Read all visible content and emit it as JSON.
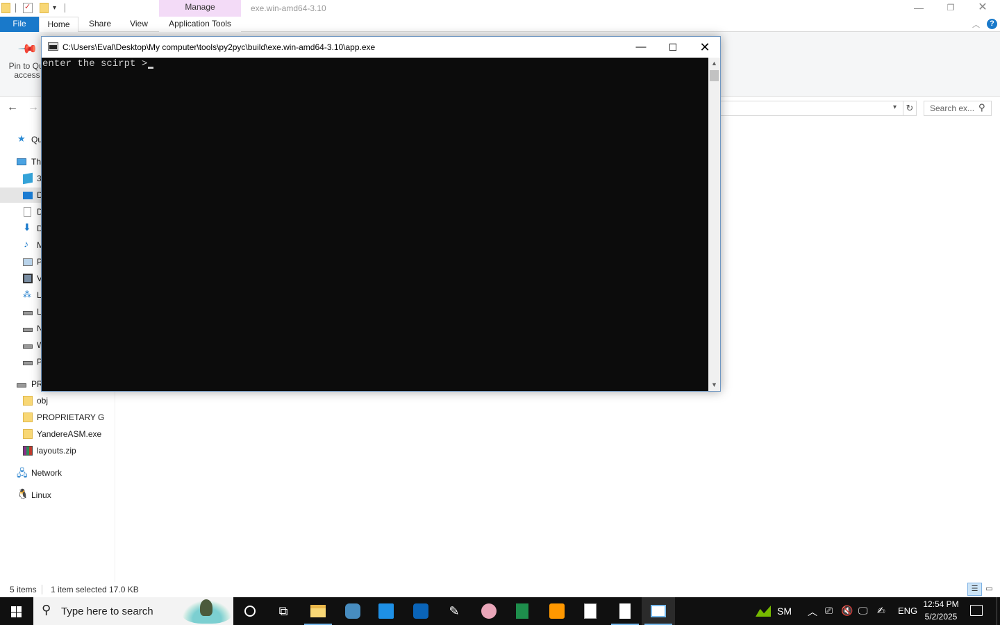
{
  "explorer": {
    "window_title": "exe.win-amd64-3.10",
    "manage_label": "Manage",
    "tabs": {
      "file": "File",
      "home": "Home",
      "share": "Share",
      "view": "View",
      "app_tools": "Application Tools"
    },
    "ribbon": {
      "pin_label_line1": "Pin to Qui",
      "pin_label_line2": "access"
    },
    "search_placeholder": "Search ex...",
    "nav": {
      "quick_access": "Qu",
      "this_pc": "Thi",
      "objects_3d": "3",
      "desktop": "D",
      "documents": "D",
      "downloads": "D",
      "music": "M",
      "pictures": "P",
      "videos": "V",
      "drive_l1": "L",
      "drive_l2": "L",
      "drive_n": "N",
      "drive_w": "W",
      "drive_p": "P",
      "proprietary_drive": "PR",
      "obj": "obj",
      "proprietary_g": "PROPRIETARY G",
      "yandere": "YandereASM.exe",
      "layouts": "layouts.zip",
      "network": "Network",
      "linux": "Linux"
    },
    "status": {
      "items": "5 items",
      "selected": "1 item selected  17.0 KB"
    }
  },
  "console": {
    "title": "C:\\Users\\Eval\\Desktop\\My computer\\tools\\py2pyc\\build\\exe.win-amd64-3.10\\app.exe",
    "prompt": "enter the scirpt > "
  },
  "taskbar": {
    "search_placeholder": "Type here to search",
    "tray": {
      "sm_label": "SM",
      "language": "ENG",
      "time": "12:54 PM",
      "date": "5/2/2025"
    }
  },
  "colors": {
    "file_tab": "#1979ca",
    "manage_band": "#f3dbf7",
    "console_bg": "#0c0c0c",
    "console_text": "#cccccc",
    "taskbar_bg": "#101010"
  }
}
